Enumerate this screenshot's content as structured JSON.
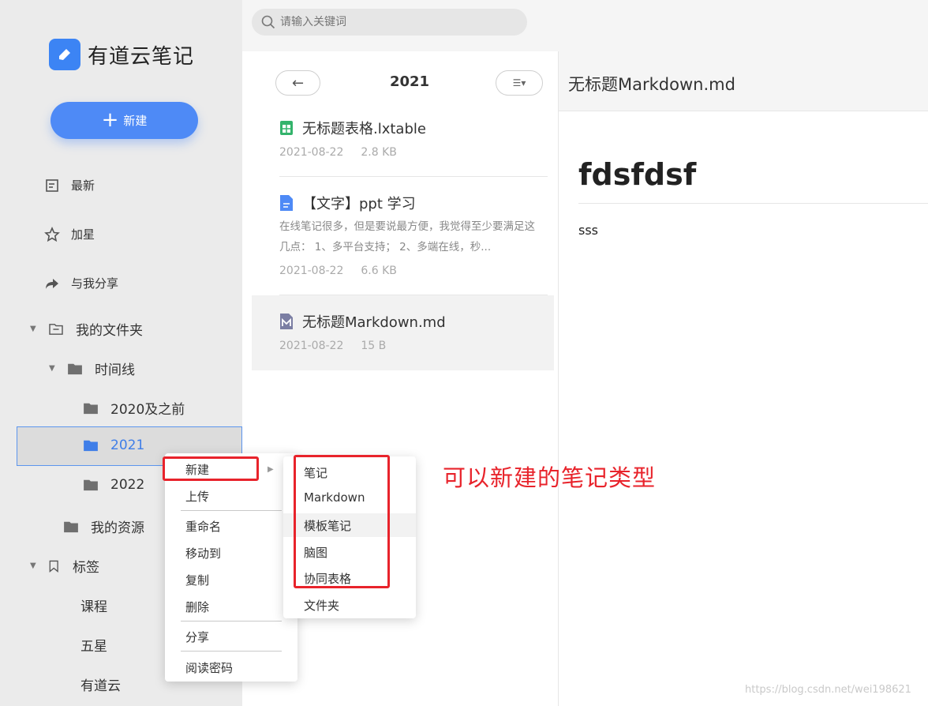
{
  "app": {
    "name": "有道云笔记"
  },
  "search": {
    "placeholder": "请输入关键词"
  },
  "sidebar": {
    "new_label": "新建",
    "nav": [
      {
        "label": "最新",
        "icon": "recent-icon"
      },
      {
        "label": "加星",
        "icon": "star-icon"
      },
      {
        "label": "与我分享",
        "icon": "share-icon"
      }
    ],
    "tree": {
      "my_folders": "我的文件夹",
      "timeline": "时间线",
      "folders": [
        "2020及之前",
        "2021",
        "2022"
      ],
      "my_resources": "我的资源",
      "tags_label": "标签",
      "tags": [
        "课程",
        "五星",
        "有道云"
      ]
    }
  },
  "note_list": {
    "title": "2021",
    "back_symbol": "←",
    "sort_symbol": "☰▾",
    "notes": [
      {
        "title": "无标题表格.lxtable",
        "date": "2021-08-22",
        "size": "2.8 KB",
        "icon": "table-icon"
      },
      {
        "title": "【文字】ppt 学习",
        "excerpt": "在线笔记很多，但是要说最方便，我觉得至少要满足这几点： 1、多平台支持； 2、多端在线，秒...",
        "date": "2021-08-22",
        "size": "6.6 KB",
        "icon": "doc-icon"
      },
      {
        "title": "无标题Markdown.md",
        "date": "2021-08-22",
        "size": "15 B",
        "icon": "markdown-icon"
      }
    ]
  },
  "editor": {
    "title": "无标题Markdown.md",
    "heading": "fdsfdsf",
    "body": "sss"
  },
  "context_menu": {
    "items": [
      "新建",
      "上传",
      "重命名",
      "移动到",
      "复制",
      "删除",
      "分享",
      "阅读密码"
    ]
  },
  "sub_menu": {
    "items": [
      "笔记",
      "Markdown",
      "模板笔记",
      "脑图",
      "协同表格",
      "文件夹"
    ]
  },
  "annotation": {
    "text": "可以新建的笔记类型",
    "color": "#e8232b"
  },
  "watermark": "https://blog.csdn.net/wei198621",
  "colors": {
    "accent": "#4e8af6",
    "highlight_border": "#5c95ee",
    "annotation": "#e8232b"
  }
}
